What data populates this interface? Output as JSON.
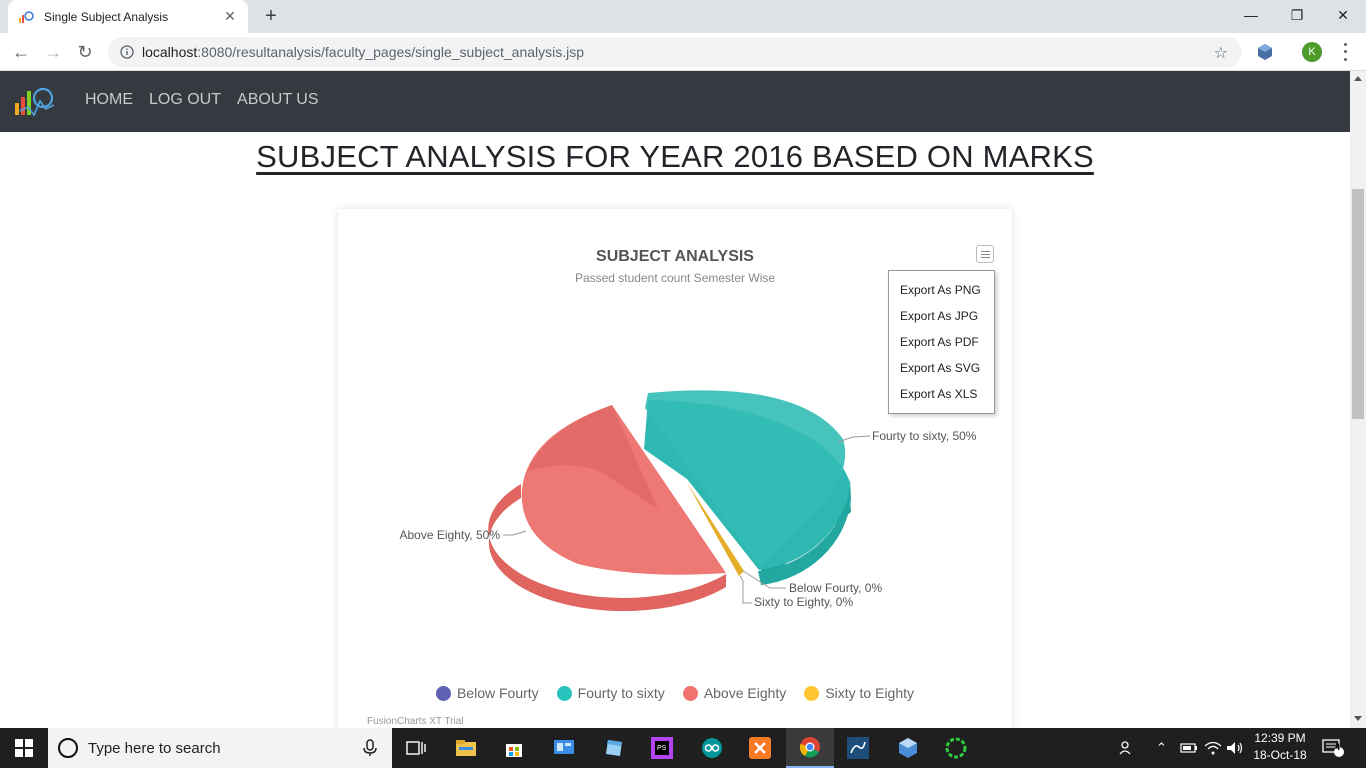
{
  "browser": {
    "tab_title": "Single Subject Analysis",
    "url_host": "localhost",
    "url_rest": ":8080/resultanalysis/faculty_pages/single_subject_analysis.jsp",
    "profile_initial": "K"
  },
  "navbar": {
    "links": [
      "HOME",
      "LOG OUT",
      "ABOUT US"
    ]
  },
  "page": {
    "heading": "SUBJECT ANALYSIS FOR YEAR 2016 BASED ON MARKS"
  },
  "export_menu": [
    "Export As PNG",
    "Export As JPG",
    "Export As PDF",
    "Export As SVG",
    "Export As XLS"
  ],
  "chart_data": {
    "type": "pie",
    "title": "SUBJECT ANALYSIS",
    "subtitle": "Passed student count Semester Wise",
    "categories": [
      "Below Fourty",
      "Fourty to sixty",
      "Above Eighty",
      "Sixty to Eighty"
    ],
    "values": [
      0,
      50,
      50,
      0
    ],
    "slice_labels": [
      "Below Fourty, 0%",
      "Fourty to sixty, 50%",
      "Above Eighty, 50%",
      "Sixty to Eighty, 0%"
    ],
    "colors": [
      "#5d62b5",
      "#29c3be",
      "#f2726f",
      "#ffc533"
    ],
    "legend_position": "bottom",
    "watermark": "FusionCharts XT Trial"
  },
  "taskbar": {
    "search_placeholder": "Type here to search",
    "time": "12:39 PM",
    "date": "18-Oct-18",
    "notification_count": "4"
  },
  "colors": {
    "navbar_bg": "#343a40",
    "taskbar_bg": "#1f1f1f"
  }
}
